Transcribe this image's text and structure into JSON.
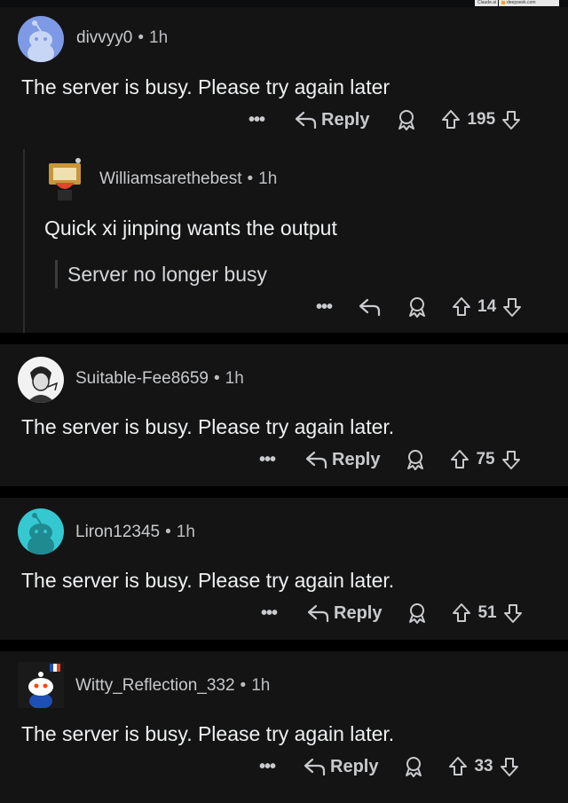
{
  "browser_tabs": [
    "Claude.ai",
    "deepseek.com"
  ],
  "comments": [
    {
      "username": "divvyy0",
      "time": "1h",
      "text": "The server is busy. Please try again later",
      "reply_label": "Reply",
      "score": "195"
    },
    {
      "username": "Williamsarethebest",
      "time": "1h",
      "text": "Quick xi jinping wants the output",
      "quote": "Server no longer busy",
      "score": "14"
    },
    {
      "username": "Suitable-Fee8659",
      "time": "1h",
      "text": "The server is busy. Please try again later.",
      "reply_label": "Reply",
      "score": "75"
    },
    {
      "username": "Liron12345",
      "time": "1h",
      "text": "The server is busy. Please try again later.",
      "reply_label": "Reply",
      "score": "51"
    },
    {
      "username": "Witty_Reflection_332",
      "time": "1h",
      "text": "The server is busy. Please try again later.",
      "reply_label": "Reply",
      "score": "33"
    }
  ],
  "colors": {
    "background": "#000000",
    "card": "#141414",
    "text": "#eef0f2",
    "muted": "#bcbec2"
  }
}
